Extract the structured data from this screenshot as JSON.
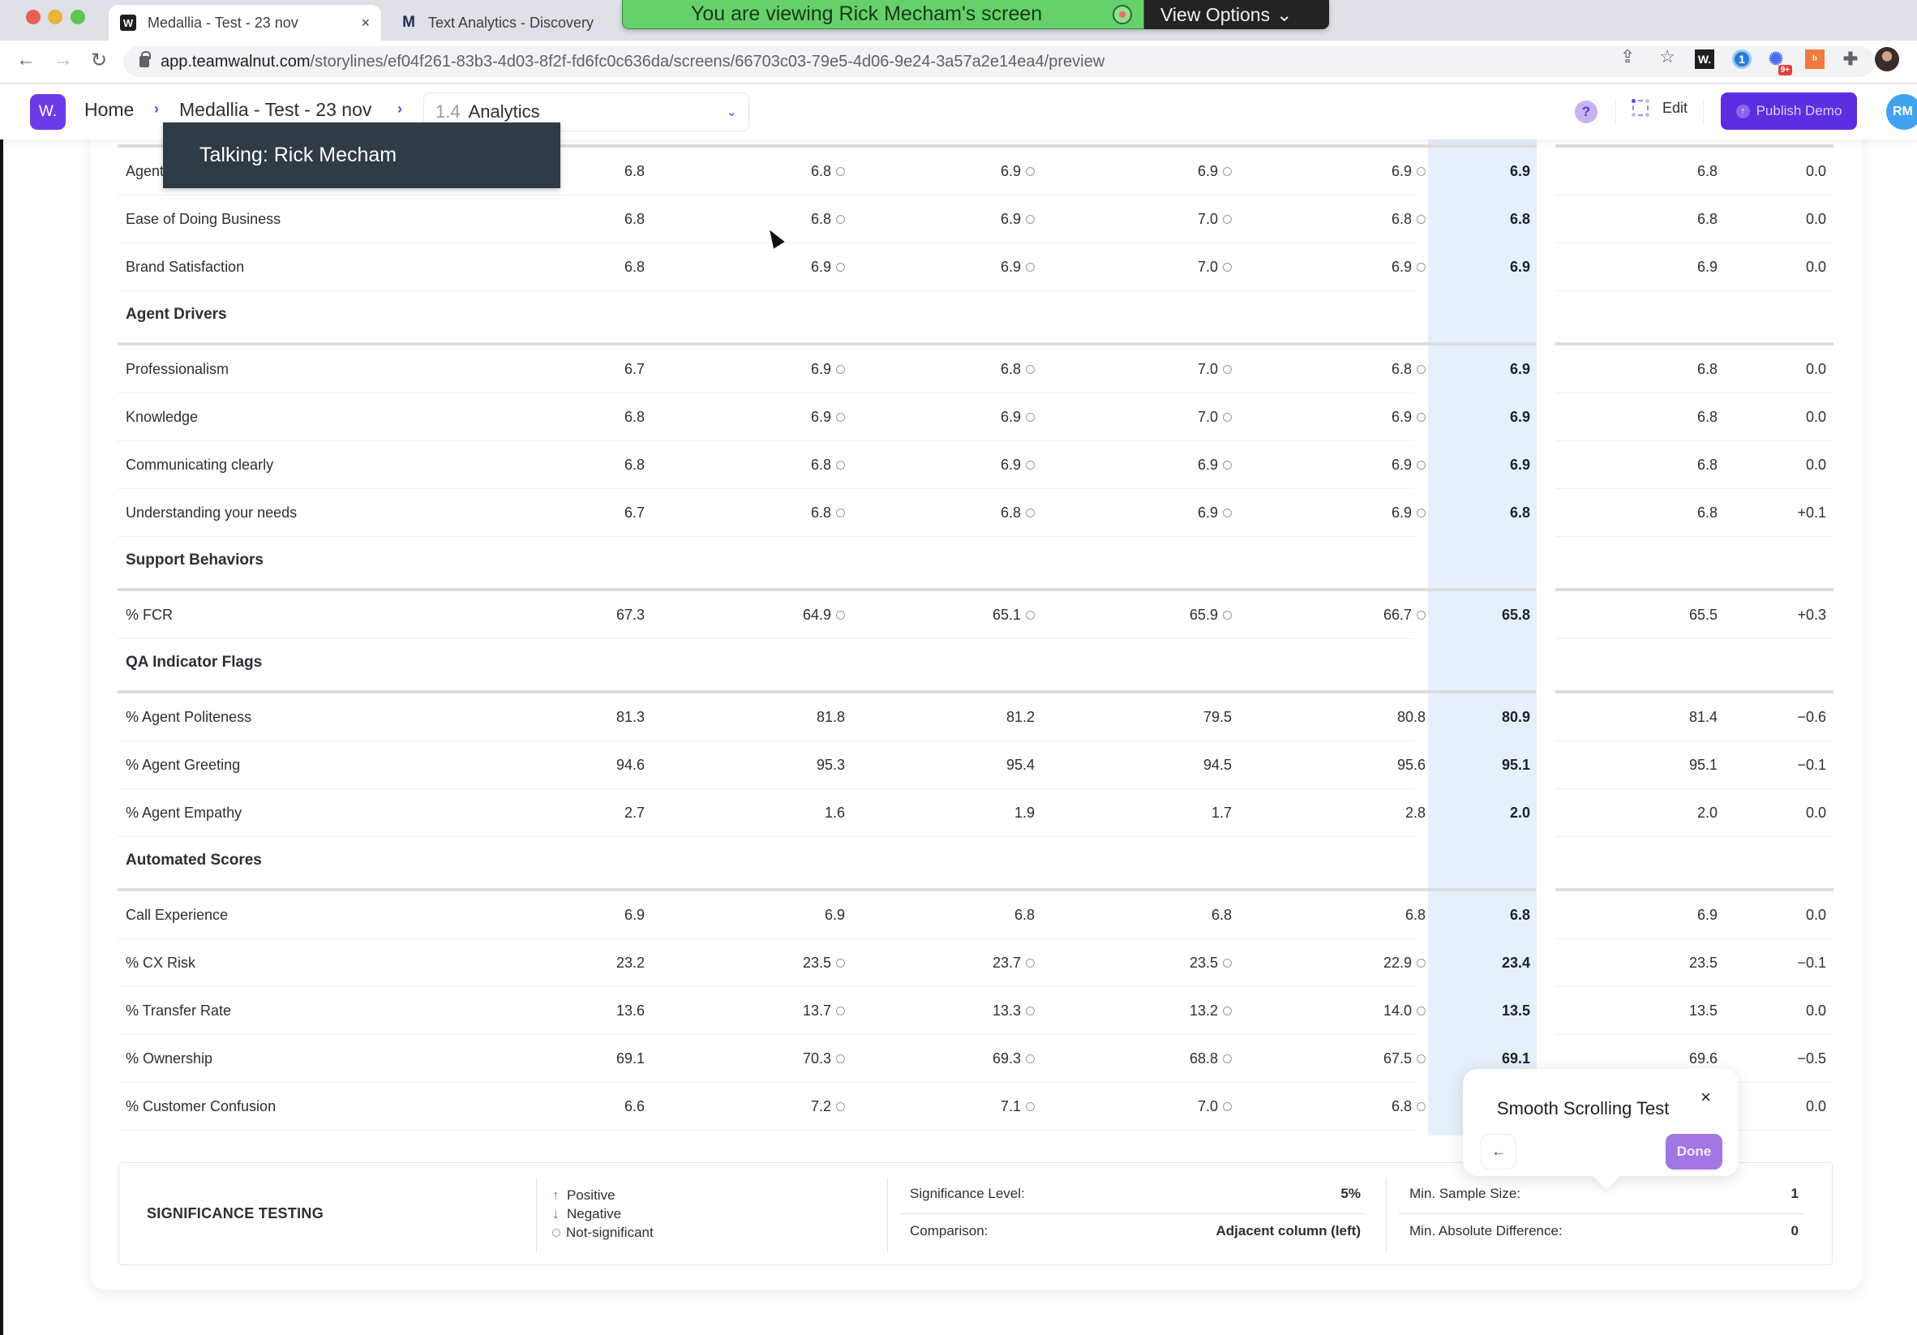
{
  "browser": {
    "tabs": [
      {
        "title": "Medallia - Test - 23 nov",
        "favicon": "walnut-w-icon",
        "active": true
      },
      {
        "title": "Text Analytics - Discovery",
        "favicon": "medallia-m-icon",
        "active": false
      }
    ],
    "close_glyph": "×",
    "url_host": "app.teamwalnut.com",
    "url_path": "/storylines/ef04f261-83b3-4d03-8f2f-fd6fc0c636da/screens/66703c03-79e5-4d06-9e24-3a57a2e14ea4/preview",
    "nav": {
      "back": "←",
      "forward": "→",
      "reload": "↻"
    },
    "omni_actions": {
      "share": "⇪",
      "bookmark": "☆"
    },
    "extensions": {
      "walnut": "W.",
      "onepassword": "1",
      "spark": "✺",
      "spark_badge": "9+",
      "hubspot": "ᵇ",
      "puzzle": "✚"
    }
  },
  "share_banner": {
    "message": "You are viewing Rick Mecham's screen",
    "options_label": "View Options",
    "options_chevron": "⌄"
  },
  "app_header": {
    "logo": "W.",
    "breadcrumb": [
      "Home",
      "Medallia - Test - 23 nov"
    ],
    "crumb_sep": "›",
    "screen_number": "1.4",
    "screen_name": "Analytics",
    "screen_chevron": "⌄",
    "help": "?",
    "edit_label": "Edit",
    "publish_label": "Publish Demo",
    "publish_icon": "↑",
    "avatar_initials": "RM"
  },
  "talking_tooltip": "Talking: Rick Mecham",
  "table": {
    "groups": [
      {
        "title": null,
        "rows": [
          {
            "label": "Agent",
            "values": [
              "6.8",
              "6.8",
              "6.9",
              "6.9",
              "6.9",
              "6.9",
              "6.8",
              "0.0"
            ],
            "ns": [
              false,
              true,
              true,
              true,
              true
            ]
          },
          {
            "label": "Ease of Doing Business",
            "values": [
              "6.8",
              "6.8",
              "6.9",
              "7.0",
              "6.8",
              "6.8",
              "6.8",
              "0.0"
            ],
            "ns": [
              false,
              true,
              true,
              true,
              true
            ]
          },
          {
            "label": "Brand Satisfaction",
            "values": [
              "6.8",
              "6.9",
              "6.9",
              "7.0",
              "6.9",
              "6.9",
              "6.9",
              "0.0"
            ],
            "ns": [
              false,
              true,
              true,
              true,
              true
            ]
          }
        ]
      },
      {
        "title": "Agent Drivers",
        "rows": [
          {
            "label": "Professionalism",
            "values": [
              "6.7",
              "6.9",
              "6.8",
              "7.0",
              "6.8",
              "6.9",
              "6.8",
              "0.0"
            ],
            "ns": [
              false,
              true,
              true,
              true,
              true
            ]
          },
          {
            "label": "Knowledge",
            "values": [
              "6.8",
              "6.9",
              "6.9",
              "7.0",
              "6.9",
              "6.9",
              "6.8",
              "0.0"
            ],
            "ns": [
              false,
              true,
              true,
              true,
              true
            ]
          },
          {
            "label": "Communicating clearly",
            "values": [
              "6.8",
              "6.8",
              "6.9",
              "6.9",
              "6.9",
              "6.9",
              "6.8",
              "0.0"
            ],
            "ns": [
              false,
              true,
              true,
              true,
              true
            ]
          },
          {
            "label": "Understanding your needs",
            "values": [
              "6.7",
              "6.8",
              "6.8",
              "6.9",
              "6.9",
              "6.8",
              "6.8",
              "+0.1"
            ],
            "ns": [
              false,
              true,
              true,
              true,
              true
            ]
          }
        ]
      },
      {
        "title": "Support Behaviors",
        "rows": [
          {
            "label": "% FCR",
            "values": [
              "67.3",
              "64.9",
              "65.1",
              "65.9",
              "66.7",
              "65.8",
              "65.5",
              "+0.3"
            ],
            "ns": [
              false,
              true,
              true,
              true,
              true
            ]
          }
        ]
      },
      {
        "title": "QA Indicator Flags",
        "rows": [
          {
            "label": "% Agent Politeness",
            "values": [
              "81.3",
              "81.8",
              "81.2",
              "79.5",
              "80.8",
              "80.9",
              "81.4",
              "−0.6"
            ],
            "ns": [
              false,
              false,
              false,
              false,
              false
            ]
          },
          {
            "label": "% Agent Greeting",
            "values": [
              "94.6",
              "95.3",
              "95.4",
              "94.5",
              "95.6",
              "95.1",
              "95.1",
              "−0.1"
            ],
            "ns": [
              false,
              false,
              false,
              false,
              false
            ]
          },
          {
            "label": "% Agent Empathy",
            "values": [
              "2.7",
              "1.6",
              "1.9",
              "1.7",
              "2.8",
              "2.0",
              "2.0",
              "0.0"
            ],
            "ns": [
              false,
              false,
              false,
              false,
              false
            ]
          }
        ]
      },
      {
        "title": "Automated Scores",
        "rows": [
          {
            "label": "Call Experience",
            "values": [
              "6.9",
              "6.9",
              "6.8",
              "6.8",
              "6.8",
              "6.8",
              "6.9",
              "0.0"
            ],
            "ns": [
              false,
              false,
              false,
              false,
              false
            ]
          },
          {
            "label": "% CX Risk",
            "values": [
              "23.2",
              "23.5",
              "23.7",
              "23.5",
              "22.9",
              "23.4",
              "23.5",
              "−0.1"
            ],
            "ns": [
              false,
              true,
              true,
              true,
              true
            ]
          },
          {
            "label": "% Transfer Rate",
            "values": [
              "13.6",
              "13.7",
              "13.3",
              "13.2",
              "14.0",
              "13.5",
              "13.5",
              "0.0"
            ],
            "ns": [
              false,
              true,
              true,
              true,
              true
            ]
          },
          {
            "label": "% Ownership",
            "values": [
              "69.1",
              "70.3",
              "69.3",
              "68.8",
              "67.5",
              "69.1",
              "69.6",
              "−0.5"
            ],
            "ns": [
              false,
              true,
              true,
              true,
              true
            ]
          },
          {
            "label": "% Customer Confusion",
            "values": [
              "6.6",
              "7.2",
              "7.1",
              "7.0",
              "6.8",
              "",
              "",
              "0.0"
            ],
            "ns": [
              false,
              true,
              true,
              true,
              true
            ]
          }
        ]
      }
    ]
  },
  "significance": {
    "title": "SIGNIFICANCE TESTING",
    "legend": {
      "positive": "Positive",
      "negative": "Negative",
      "not_significant": "Not-significant",
      "up": "↑",
      "down": "↓"
    },
    "significance_level_label": "Significance Level:",
    "significance_level_value": "5%",
    "comparison_label": "Comparison:",
    "comparison_value": "Adjacent column (left)",
    "min_sample_label": "Min. Sample Size:",
    "min_sample_value": "1",
    "min_abs_diff_label": "Min. Absolute Difference:",
    "min_abs_diff_value": "0"
  },
  "guide_popover": {
    "title": "Smooth Scrolling Test",
    "close": "×",
    "back": "←",
    "done": "Done"
  }
}
